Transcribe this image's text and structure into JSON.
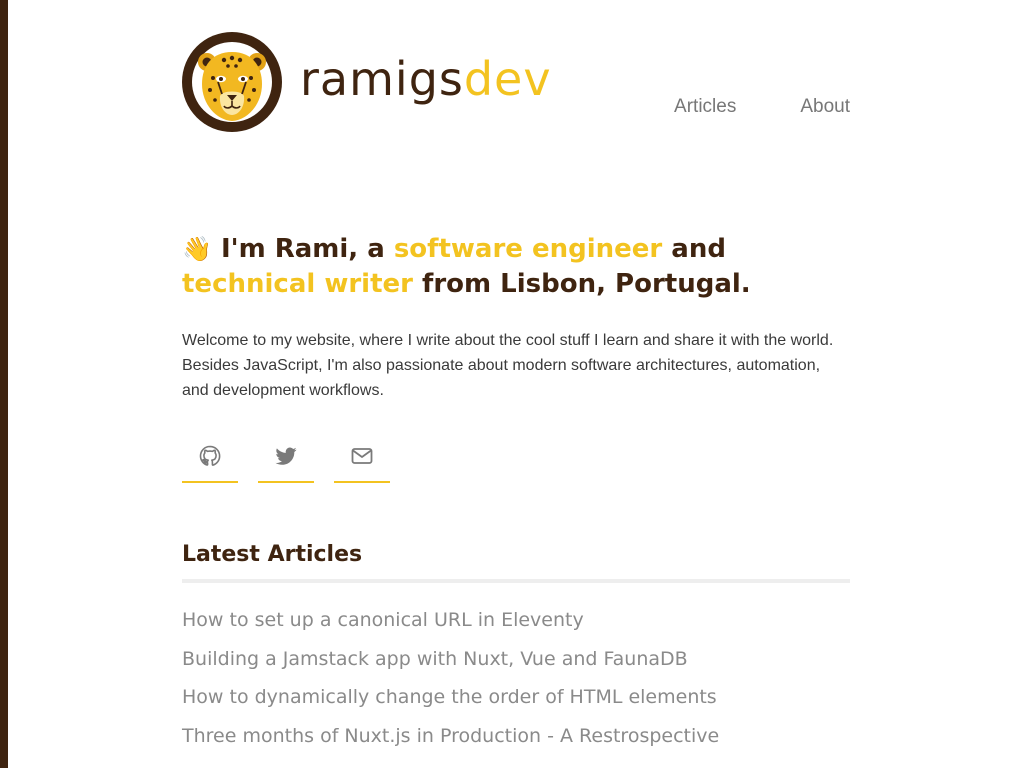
{
  "brand": {
    "name_part1": "ramigs",
    "name_part2": "dev",
    "dark_color": "#3f2410",
    "accent_color": "#f3c320",
    "logo_icon": "leopard-icon"
  },
  "nav": {
    "items": [
      {
        "label": "Articles"
      },
      {
        "label": "About"
      }
    ]
  },
  "hero": {
    "emoji": "👋",
    "segments": [
      {
        "text": " I'm Rami, a ",
        "accent": false
      },
      {
        "text": "software engineer",
        "accent": true
      },
      {
        "text": " and ",
        "accent": false
      },
      {
        "text": "technical writer",
        "accent": true
      },
      {
        "text": " from Lisbon, Portugal.",
        "accent": false
      }
    ],
    "intro": "Welcome to my website, where I write about the cool stuff I learn and share it with the world. Besides JavaScript, I'm also passionate about modern software architectures, automation, and development workflows."
  },
  "social": [
    {
      "icon": "github-icon"
    },
    {
      "icon": "twitter-icon"
    },
    {
      "icon": "mail-icon"
    }
  ],
  "latest": {
    "title": "Latest Articles",
    "articles": [
      {
        "title": "How to set up a canonical URL in Eleventy"
      },
      {
        "title": "Building a Jamstack app with Nuxt, Vue and FaunaDB"
      },
      {
        "title": "How to dynamically change the order of HTML elements"
      },
      {
        "title": "Three months of Nuxt.js in Production - A Restrospective"
      }
    ]
  }
}
